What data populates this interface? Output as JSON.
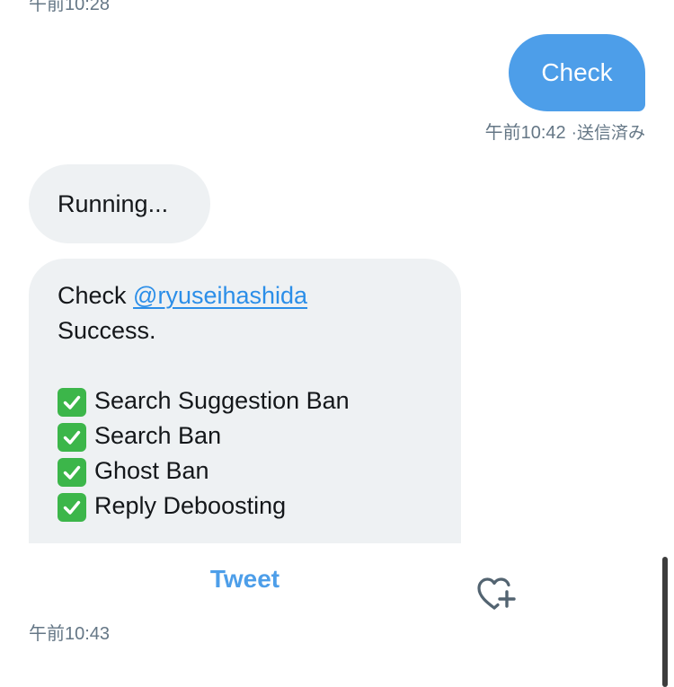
{
  "thread": {
    "top_timestamp": "午前10:28",
    "outgoing": {
      "text": "Check",
      "time": "午前10:42",
      "status": "·送信済み"
    },
    "incoming_running": "Running...",
    "result": {
      "check_word": "Check",
      "mention": "@ryuseihashida",
      "success": "Success.",
      "items": [
        "Search Suggestion Ban",
        "Search Ban",
        "Ghost Ban",
        "Reply Deboosting"
      ],
      "status_icon": "white-check-mark-icon",
      "status_color": "#3cb64a"
    },
    "quick_reply_button": "Tweet",
    "add_reaction_icon": "heart-plus-icon",
    "bottom_timestamp": "午前10:43"
  },
  "colors": {
    "outgoing_bubble": "#4d9ee9",
    "incoming_bubble": "#eef1f3",
    "link": "#2b8ee8",
    "meta_text": "#657786"
  }
}
